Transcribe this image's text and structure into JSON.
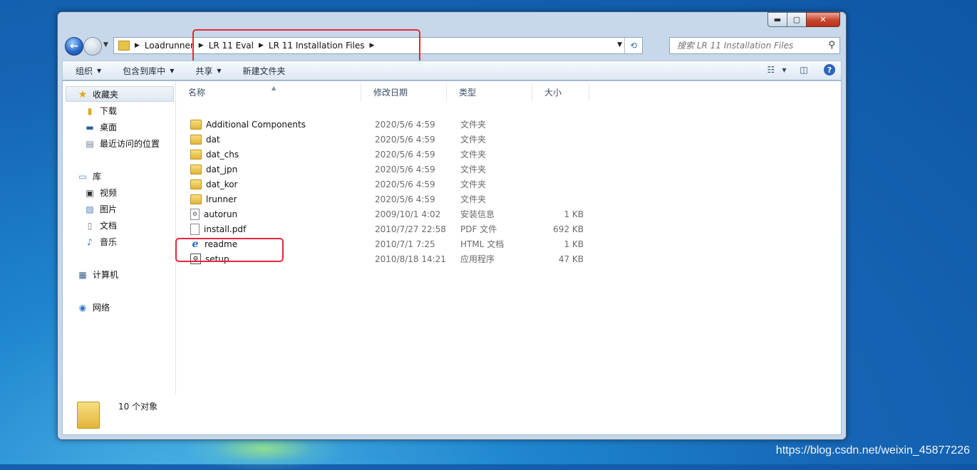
{
  "window": {
    "nav": {
      "breadcrumb": [
        "Loadrunner",
        "LR 11 Eval",
        "LR 11 Installation Files"
      ]
    },
    "search": {
      "placeholder": "搜索 LR 11 Installation Files"
    },
    "toolbar": {
      "organize": "组织",
      "include_in_library": "包含到库中",
      "share": "共享",
      "new_folder": "新建文件夹"
    },
    "sidebar": {
      "favorites": "收藏夹",
      "favorites_items": [
        "下载",
        "桌面",
        "最近访问的位置"
      ],
      "libraries": "库",
      "libraries_items": [
        "视频",
        "图片",
        "文档",
        "音乐"
      ],
      "computer": "计算机",
      "network": "网络"
    },
    "columns": {
      "name": "名称",
      "date": "修改日期",
      "type": "类型",
      "size": "大小"
    },
    "files": [
      {
        "name": "Additional Components",
        "date": "2020/5/6 4:59",
        "type": "文件夹",
        "size": "",
        "icon": "folder-icon"
      },
      {
        "name": "dat",
        "date": "2020/5/6 4:59",
        "type": "文件夹",
        "size": "",
        "icon": "folder-icon"
      },
      {
        "name": "dat_chs",
        "date": "2020/5/6 4:59",
        "type": "文件夹",
        "size": "",
        "icon": "folder-icon"
      },
      {
        "name": "dat_jpn",
        "date": "2020/5/6 4:59",
        "type": "文件夹",
        "size": "",
        "icon": "folder-icon"
      },
      {
        "name": "dat_kor",
        "date": "2020/5/6 4:59",
        "type": "文件夹",
        "size": "",
        "icon": "folder-icon"
      },
      {
        "name": "lrunner",
        "date": "2020/5/6 4:59",
        "type": "文件夹",
        "size": "",
        "icon": "folder-icon"
      },
      {
        "name": "autorun",
        "date": "2009/10/1 4:02",
        "type": "安装信息",
        "size": "1 KB",
        "icon": "settings-file-icon"
      },
      {
        "name": "install.pdf",
        "date": "2010/7/27 22:58",
        "type": "PDF 文件",
        "size": "692 KB",
        "icon": "document-icon"
      },
      {
        "name": "readme",
        "date": "2010/7/1 7:25",
        "type": "HTML 文档",
        "size": "1 KB",
        "icon": "ie-document-icon"
      },
      {
        "name": "setup",
        "date": "2010/8/18 14:21",
        "type": "应用程序",
        "size": "47 KB",
        "icon": "setup-exe-icon"
      }
    ],
    "status": {
      "count": "10 个对象"
    }
  },
  "watermark": "https://blog.csdn.net/weixin_45877226",
  "colors": {
    "highlight": "#e8263a",
    "desktop": "#1565b4"
  }
}
